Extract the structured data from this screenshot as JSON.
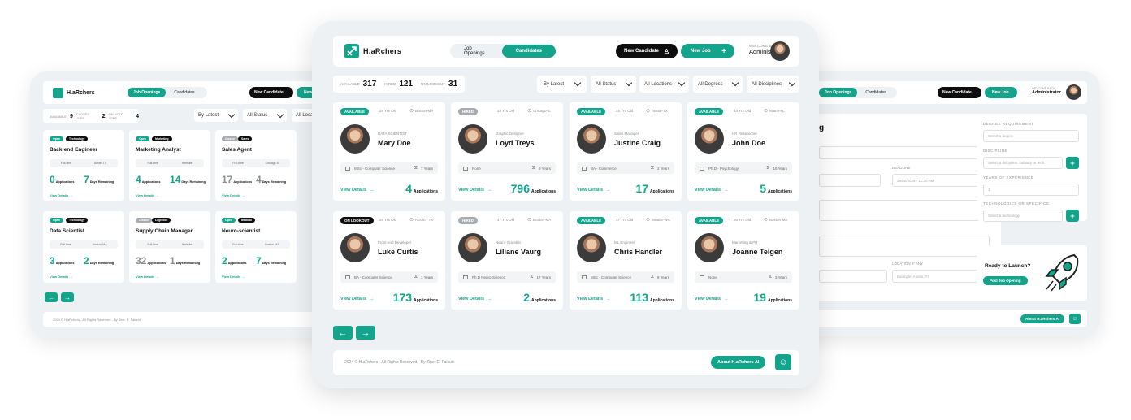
{
  "brand": {
    "name": "H.aRchers"
  },
  "nav": {
    "job_openings": "Job Openings",
    "candidates": "Candidates"
  },
  "header": {
    "new_candidate": "New Candidate",
    "new_job": "New Job",
    "welcome": "WELCOME BACK",
    "user": "Administrator"
  },
  "stats": {
    "available_label": "AVAILABLE",
    "available": "317",
    "hired_label": "HIRED",
    "hired": "121",
    "lookout_label": "ON LOOKOUT",
    "lookout": "31"
  },
  "filters": [
    "By Latest",
    "All Status",
    "All Locations",
    "All Degress",
    "All Disciplines"
  ],
  "candidates": [
    {
      "status": "AVAILABLE",
      "status_color": "#14a48c",
      "ago": "29 Yrs Old",
      "location": "Boston-MA",
      "role": "DATA SCIENTIST",
      "name": "Mary Doe",
      "degree": "MSc - Computer Science",
      "exp": "7 Years",
      "apps": "4",
      "apps_label": "Applications",
      "view": "View Details"
    },
    {
      "status": "HIRED",
      "status_color": "#a8acb0",
      "ago": "33 Yrs Old",
      "location": "Chicago-IL",
      "role": "Graphic Designer",
      "name": "Loyd Treys",
      "degree": "None",
      "exp": "9 Years",
      "apps": "796",
      "apps_label": "Applications",
      "view": "View Details"
    },
    {
      "status": "AVAILABLE",
      "status_color": "#14a48c",
      "ago": "25 Yrs Old",
      "location": "Austin-TX",
      "role": "Sales Manager",
      "name": "Justine Craig",
      "degree": "BA - Commerce",
      "exp": "2 Years",
      "apps": "17",
      "apps_label": "Applications",
      "view": "View Details"
    },
    {
      "status": "AVAILABLE",
      "status_color": "#14a48c",
      "ago": "44 Yrs Old",
      "location": "Miami-FL",
      "role": "HR Researcher",
      "name": "John Doe",
      "degree": "Ph.D - Psychology",
      "exp": "16 Years",
      "apps": "5",
      "apps_label": "Applications",
      "view": "View Details"
    },
    {
      "status": "ON LOOKOUT",
      "status_color": "#0e0e0e",
      "ago": "28 Yrs Old",
      "location": "Austin - TX",
      "role": "Front-end Developer",
      "name": "Luke Curtis",
      "degree": "BA - Computer Science",
      "exp": "1 Years",
      "apps": "173",
      "apps_label": "Applications",
      "view": "View Details"
    },
    {
      "status": "HIRED",
      "status_color": "#a8acb0",
      "ago": "47 Yrs Old",
      "location": "Boston-MA",
      "role": "Neuro-Scientist",
      "name": "Liliane Vaurg",
      "degree": "Ph.D Neuro-Science",
      "exp": "17 Years",
      "apps": "2",
      "apps_label": "Applications",
      "view": "View Details"
    },
    {
      "status": "AVAILABLE",
      "status_color": "#14a48c",
      "ago": "37 Yrs Old",
      "location": "Seattle-WA",
      "role": "ML Engineer",
      "name": "Chris Handler",
      "degree": "MSc - Computer Science",
      "exp": "8 Years",
      "apps": "113",
      "apps_label": "Applications",
      "view": "View Details"
    },
    {
      "status": "AVAILABLE",
      "status_color": "#14a48c",
      "ago": "26 Yrs Old",
      "location": "Boston-MA",
      "role": "Marketing & PR",
      "name": "Joanne Teigen",
      "degree": "None",
      "exp": "3 Years",
      "apps": "19",
      "apps_label": "Applications",
      "view": "View Details"
    }
  ],
  "footer": {
    "copyright": "2024 © H.aRchers - All Rights Reserved - By Zine. E. Falouti",
    "about": "About H.aRchers AI"
  },
  "left": {
    "stats": {
      "available_label": "AVAILABLE",
      "available": "9",
      "closed_label": "CLOSED JOBS",
      "closed": "2",
      "closed_label2": "ON HOLD JOBS",
      "closed2": "4"
    },
    "filters": [
      "By Latest",
      "All Status",
      "All Locations"
    ],
    "jobs": [
      {
        "tags": [
          "Open",
          "Technology"
        ],
        "title": "Back-end Engineer",
        "type": "Full-time",
        "loc": "Austin-TX",
        "apps": "0",
        "apps_label": "Applications",
        "days": "7",
        "days_label": "Days Remaining",
        "view": "View Details"
      },
      {
        "tags": [
          "Open",
          "Marketing"
        ],
        "title": "Marketing Analyst",
        "type": "Full-time",
        "loc": "Website",
        "apps": "4",
        "apps_label": "Applications",
        "days": "14",
        "days_label": "Days Remaining",
        "view": "View Details"
      },
      {
        "tags": [
          "Closed",
          "Sales"
        ],
        "title": "Sales Agent",
        "type": "Full-time",
        "loc": "Chicago-IL",
        "apps": "17",
        "apps_label": "Applications",
        "days": "4",
        "days_label": "Days Remaining",
        "view": "View Details"
      },
      {
        "tags": [
          "Open",
          "Technology"
        ],
        "title": "Data Scientist",
        "type": "Full-time",
        "loc": "Boston-MA",
        "apps": "3",
        "apps_label": "Applications",
        "days": "2",
        "days_label": "Days Remaining",
        "view": "View Details"
      },
      {
        "tags": [
          "Closed",
          "Logistics"
        ],
        "title": "Supply Chain Manager",
        "type": "Full-time",
        "loc": "Website",
        "apps": "32",
        "apps_label": "Applications",
        "days": "1",
        "days_label": "Days Remaining",
        "view": "View Details"
      },
      {
        "tags": [
          "Open",
          "Medical"
        ],
        "title": "Neuro-scientist",
        "type": "Full-time",
        "loc": "Boston-MA",
        "apps": "2",
        "apps_label": "Applications",
        "days": "7",
        "days_label": "Days Remaining",
        "view": "View Details"
      }
    ],
    "footer": "2024 © H.aRchers - All Rights Reserved - By Zine. E. Falouti"
  },
  "right": {
    "labels": {
      "deadline": "DEADLINE",
      "location": "LOCATION IF ANY",
      "degree": "DEGREE REQUIREMENT",
      "discipline": "DISCIPLINE",
      "experience": "YEARS OF EXPERIENCE",
      "tech": "TECHNOLOGIES OR SPECIFICS"
    },
    "placeholders": {
      "deadline": "28/02/2025 - 11:30 AM",
      "location": "Example: Austin, TX",
      "degree": "Select a degree",
      "discipline": "Select a discipline, industry or tech",
      "experience": "1",
      "tech": "Select a technology"
    },
    "launch": "Ready to Launch?",
    "post": "Post Job Opening"
  }
}
